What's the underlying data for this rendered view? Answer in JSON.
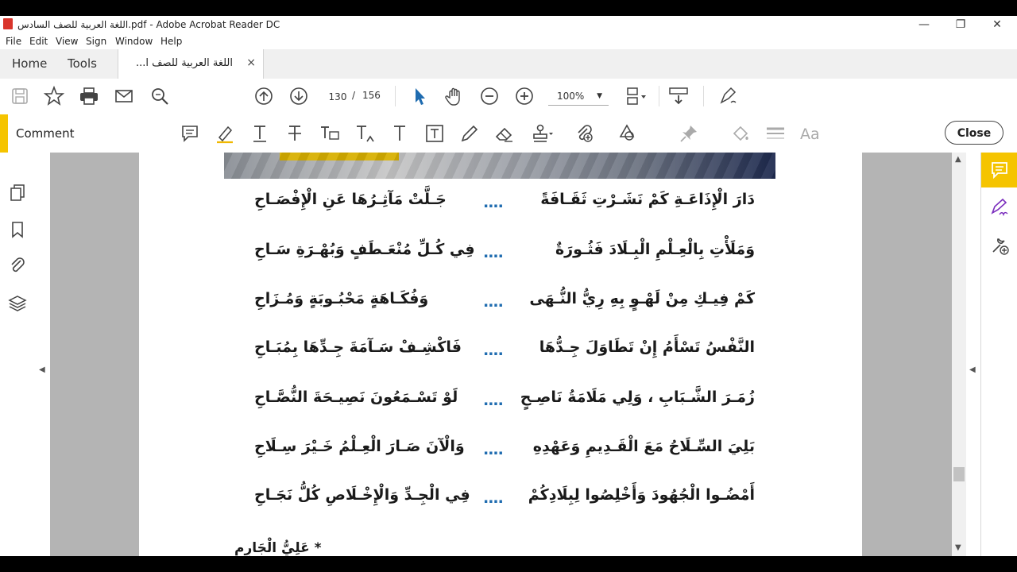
{
  "window": {
    "title": "اللغة العربية للصف السادس.pdf - Adobe Acrobat Reader DC",
    "minimize": "—",
    "restore": "❐",
    "close": "✕"
  },
  "menu": [
    "File",
    "Edit",
    "View",
    "Sign",
    "Window",
    "Help"
  ],
  "tabs": {
    "home": "Home",
    "tools": "Tools",
    "document": "اللغة العربية للصف ا...",
    "close": "×"
  },
  "toolbar": {
    "page_current": "130",
    "page_separator": "/",
    "page_total": "156",
    "zoom": "100%",
    "zoom_caret": "▼"
  },
  "comment_bar": {
    "label": "Comment",
    "close_button": "Close"
  },
  "document": {
    "verses": [
      {
        "right": "دَارَ الْإِذَاعَـةِ كَمْ نَشَـرْتِ ثَقَـافَةً",
        "separator": "....",
        "left": "جَـلَّتْ مَآثِـرُهَا عَنِ الْإِفْصَـاحِ"
      },
      {
        "right": "وَمَلَأْتِ بِالْعِـلْمِ الْبِـلَادَ فَثُـورَةٌ",
        "separator": "....",
        "left": "فِي كُـلِّ مُنْعَـطَفٍ وَبُهْـرَةِ سَـاحِ"
      },
      {
        "right": "كَمْ فِيـكِ مِنْ لَهْـوٍ بِهِ رِيُّ النُّـهَى",
        "separator": "....",
        "left": "وَفُكَـاهَةٍ مَحْبُـوبَةٍ وَمُـزَاحِ"
      },
      {
        "right": "النَّفْسُ تَسْأَمُ إِنْ تَطَاوَلَ جِـدُّهَا",
        "separator": "....",
        "left": "فَاكْشِـفْ سَـآمَةَ جِـدِّهَا بِمُبَـاحِ"
      },
      {
        "right": "زُمَـرَ الشَّـبَابِ ، وَلِي مَلَامَةُ نَاصِـحٍ",
        "separator": "....",
        "left": "لَوْ تَسْـمَعُونَ نَصِيـحَةَ النُّصَّـاحِ"
      },
      {
        "right": "بَلِيَ السِّـلَاحُ مَعَ الْقَـدِيمِ وَعَهْدِهِ",
        "separator": "....",
        "left": "وَالْآنَ صَـارَ الْعِـلْمُ خَـيْرَ سِـلَاحِ"
      },
      {
        "right": "أَمْضُـوا الْجُهُودَ وَأَخْلِصُوا لِبِلَادِكُمْ",
        "separator": "....",
        "left": "فِي الْجِـدِّ وَالْإِخْـلَاصِ كُلُّ نَجَـاحِ"
      }
    ],
    "author": "* عَلِيُّ الْجَارِمِ"
  }
}
